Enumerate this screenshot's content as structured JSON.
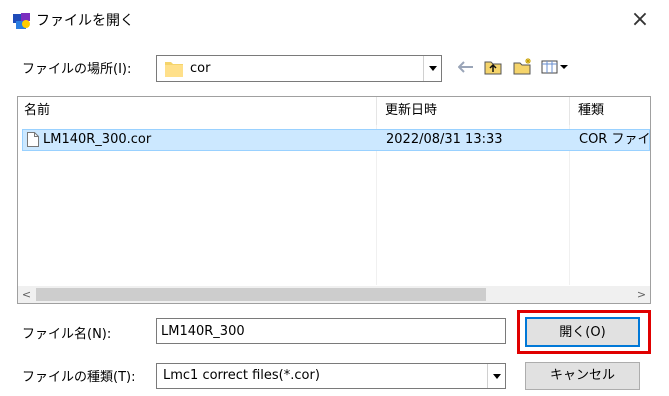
{
  "window": {
    "title": "ファイルを開く",
    "close_glyph": "×"
  },
  "location": {
    "label": "ファイルの場所(I):",
    "value": "cor"
  },
  "toolbar": {
    "icons": [
      "back-arrow-icon",
      "up-folder-icon",
      "new-folder-icon",
      "view-menu-icon"
    ]
  },
  "list": {
    "columns": [
      "名前",
      "更新日時",
      "種類"
    ],
    "sort_glyph": "^",
    "rows": [
      {
        "name": "LM140R_300.cor",
        "modified": "2022/08/31 13:33",
        "type": "COR ファイ"
      }
    ],
    "scroll_left": "<",
    "scroll_right": ">"
  },
  "filename": {
    "label": "ファイル名(N):",
    "value": "LM140R_300"
  },
  "filetype": {
    "label": "ファイルの種類(T):",
    "value": "Lmc1 correct files(*.cor)"
  },
  "buttons": {
    "open": "開く(O)",
    "cancel": "キャンセル"
  },
  "colors": {
    "highlight": "#e00000",
    "selection": "#cce8ff",
    "folder": "#f5d46b"
  }
}
